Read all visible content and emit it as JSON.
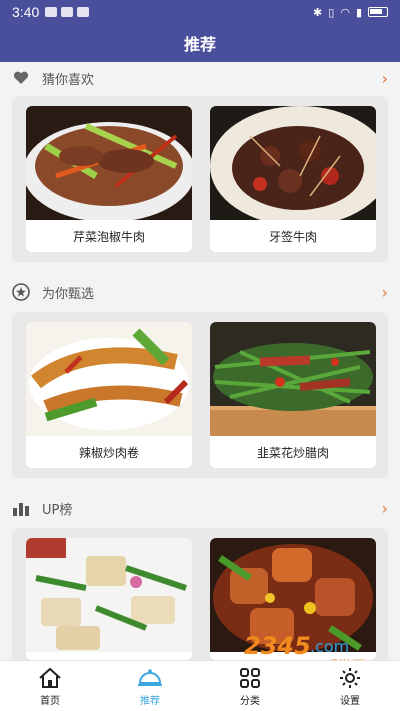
{
  "status": {
    "time": "3:40"
  },
  "header": {
    "title": "推荐"
  },
  "sections": [
    {
      "title": "猜你喜欢",
      "icon": "heart-icon",
      "items": [
        {
          "name": "芹菜泡椒牛肉"
        },
        {
          "name": "牙签牛肉"
        }
      ]
    },
    {
      "title": "为你甄选",
      "icon": "star-badge-icon",
      "items": [
        {
          "name": "辣椒炒肉卷"
        },
        {
          "name": "韭菜花炒腊肉"
        }
      ]
    },
    {
      "title": "UP榜",
      "icon": "bar-chart-icon",
      "items": [
        {
          "name": ""
        },
        {
          "name": ""
        }
      ]
    }
  ],
  "tabbar": [
    {
      "label": "首页",
      "icon": "home-icon"
    },
    {
      "label": "推荐",
      "icon": "cloche-icon",
      "active": true
    },
    {
      "label": "分类",
      "icon": "grid-icon"
    },
    {
      "label": "设置",
      "icon": "gear-icon"
    }
  ],
  "watermark": {
    "text": "2345.com",
    "sub": "手游网"
  },
  "colors": {
    "header": "#4a4f9c",
    "accent": "#3ba6e0",
    "chevron": "#e07a3a"
  }
}
